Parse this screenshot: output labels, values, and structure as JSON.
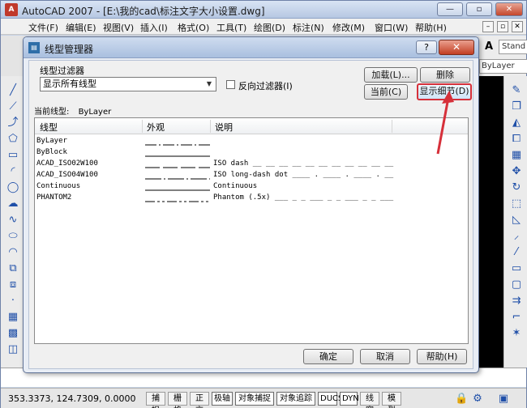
{
  "app": {
    "title": "AutoCAD 2007 - [E:\\我的cad\\标注文字大小设置.dwg]",
    "icon_text": "A",
    "win_buttons": [
      "—",
      "▫",
      "✕"
    ]
  },
  "menubar": {
    "items": [
      "文件(F)",
      "编辑(E)",
      "视图(V)",
      "插入(I)",
      "格式(O)",
      "工具(T)",
      "绘图(D)",
      "标注(N)",
      "修改(M)",
      "窗口(W)",
      "帮助(H)"
    ],
    "mdi_buttons": [
      "–",
      "▫",
      "✕"
    ]
  },
  "toolbar": {
    "style_combo": "Stand",
    "layer_combo": "ByLayer"
  },
  "dialog": {
    "title": "线型管理器",
    "help_button": "?",
    "close_button": "✕",
    "filter": {
      "group_label": "线型过滤器",
      "selected": "显示所有线型",
      "invert_label": "反向过滤器(I)",
      "invert_checked": false
    },
    "buttons": {
      "load": "加载(L)...",
      "delete": "删除",
      "current": "当前(C)",
      "show_details": "显示细节(D)",
      "ok": "确定",
      "cancel": "取消",
      "help": "帮助(H)"
    },
    "current_linetype": {
      "label": "当前线型:",
      "value": "ByLayer"
    },
    "list": {
      "columns": [
        "线型",
        "外观",
        "说明"
      ],
      "rows": [
        {
          "name": "ByLayer",
          "look": "dashdot",
          "desc": ""
        },
        {
          "name": "ByBlock",
          "look": "solid",
          "desc": ""
        },
        {
          "name": "ACAD_ISO02W100",
          "look": "dash",
          "desc": "ISO dash __ __ __ __ __ __ __ __ __ __ __"
        },
        {
          "name": "ACAD_ISO04W100",
          "look": "longdashdot",
          "desc": "ISO long-dash dot ____ . ____ . ____ . __"
        },
        {
          "name": "Continuous",
          "look": "solid",
          "desc": "Continuous"
        },
        {
          "name": "PHANTOM2",
          "look": "phantom",
          "desc": "Phantom (.5x) ___ _ _ ___ _ _ ___ _ _ ___"
        }
      ]
    }
  },
  "statusbar": {
    "coords": "353.3373, 124.7309, 0.0000",
    "toggles": [
      "捕捉",
      "栅格",
      "正交",
      "极轴",
      "对象捕捉",
      "对象追踪",
      "DUCS",
      "DYN",
      "线宽",
      "模型"
    ]
  },
  "colors": {
    "highlight": "#d6303a",
    "canvas": "#000000"
  }
}
